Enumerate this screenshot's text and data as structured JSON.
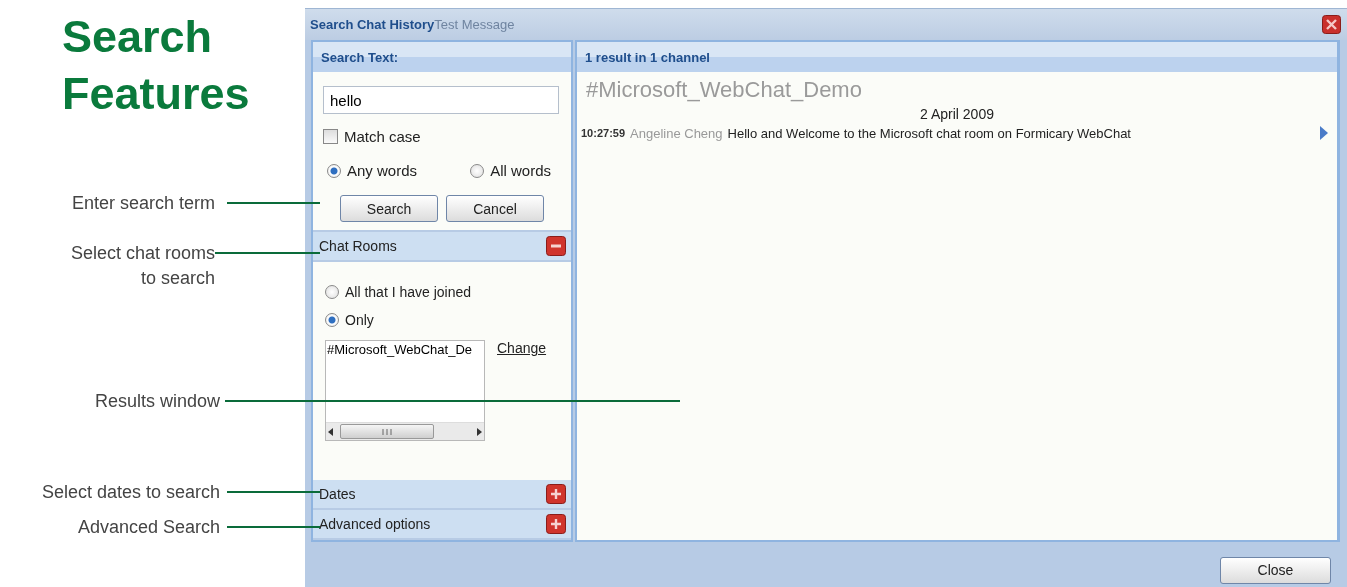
{
  "heading": "Search Features",
  "annotations": [
    {
      "text": "Enter search term"
    },
    {
      "text": "Select chat rooms to search"
    },
    {
      "text": "Results window"
    },
    {
      "text": "Select dates to search"
    },
    {
      "text": "Advanced Search"
    }
  ],
  "window": {
    "title": "Search Chat History",
    "background_title": "Test Message"
  },
  "search_panel": {
    "header": "Search Text:",
    "query": "hello",
    "match_case": {
      "label": "Match case",
      "checked": false
    },
    "word_mode": [
      {
        "label": "Any words",
        "selected": true
      },
      {
        "label": "All words",
        "selected": false
      }
    ],
    "buttons": [
      "Search",
      "Cancel"
    ]
  },
  "sections": [
    {
      "title": "Chat Rooms",
      "expanded": true,
      "options": [
        {
          "label": "All that I have joined",
          "selected": false
        },
        {
          "label": "Only",
          "selected": true
        }
      ],
      "rooms": [
        "#Microsoft_WebChat_De"
      ],
      "link": "Change"
    },
    {
      "title": "Dates",
      "expanded": false
    },
    {
      "title": "Advanced options",
      "expanded": false
    }
  ],
  "results": {
    "header": "1 result in 1 channel",
    "channel": "#Microsoft_WebChat_Demo",
    "date": "2 April 2009",
    "messages": [
      {
        "time": "10:27:59",
        "author": "Angeline Cheng",
        "text": "Hello and Welcome to the Microsoft chat room on Formicary WebChat"
      }
    ]
  },
  "footer_buttons": [
    "Close"
  ]
}
